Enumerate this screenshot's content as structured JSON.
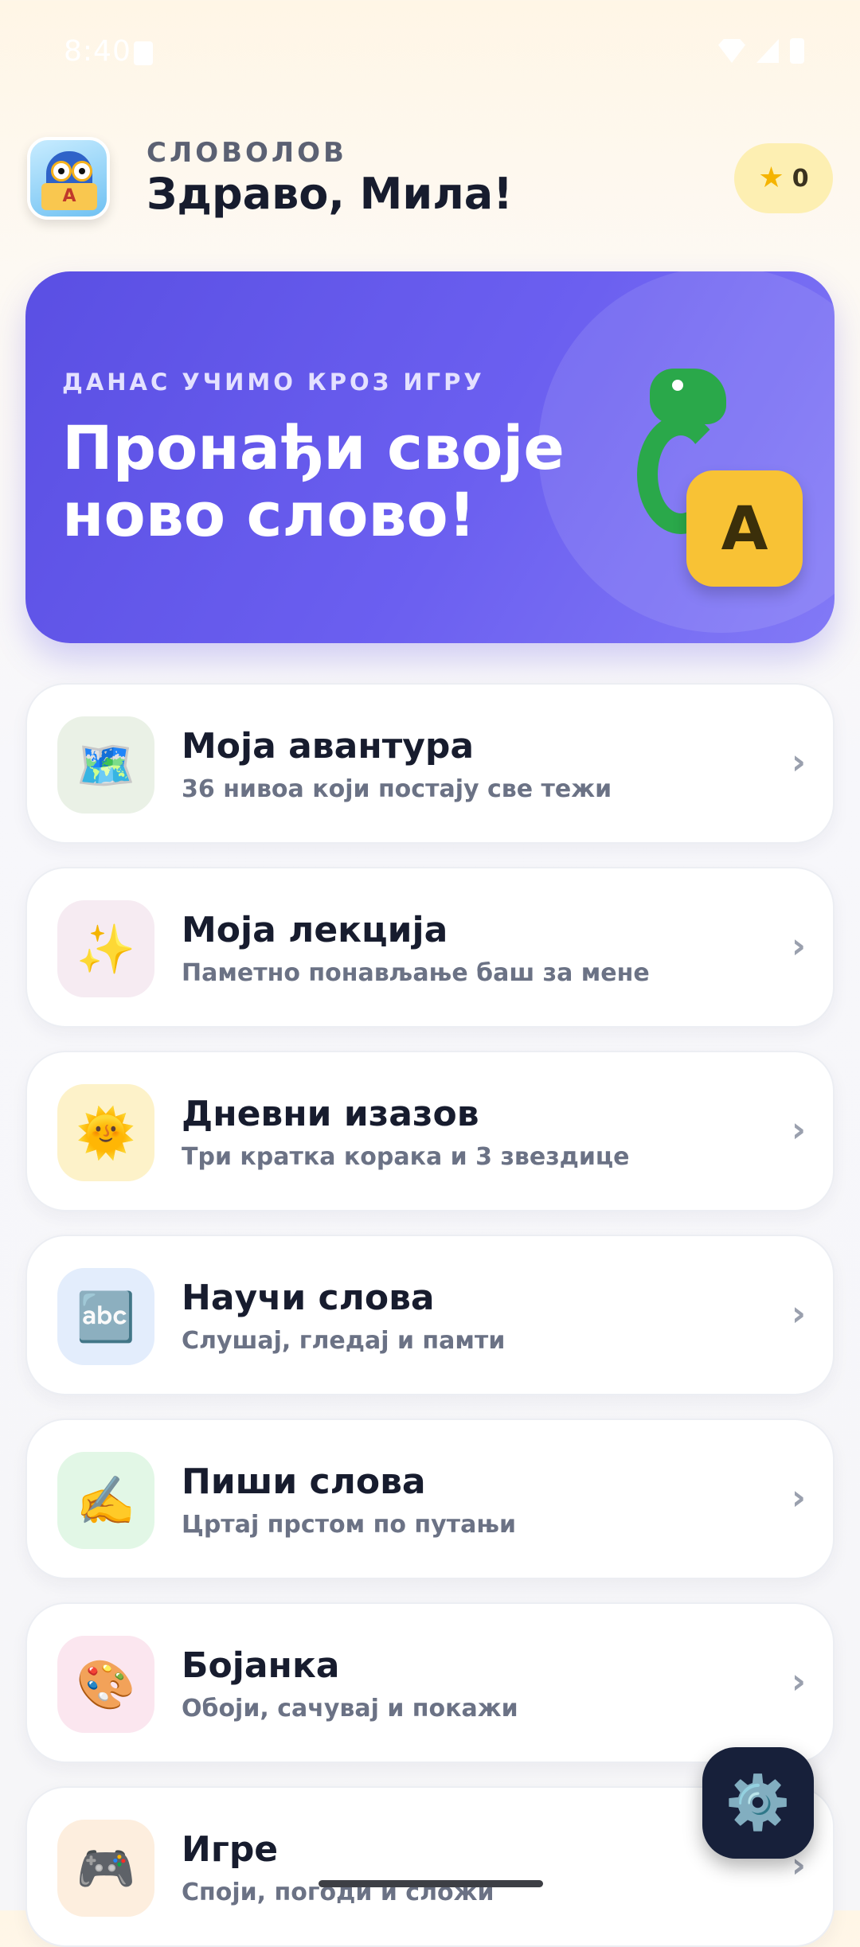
{
  "status_bar": {
    "time": "8:40"
  },
  "header": {
    "app_name": "СЛОВОЛОВ",
    "greeting": "Здраво, Мила!",
    "logo_letter": "A",
    "stars_count": "0"
  },
  "hero": {
    "kicker": "ДАНАС УЧИМО КРОЗ ИГРУ",
    "title": "Пронађи своје ново слово!",
    "letter": "А"
  },
  "menu": {
    "items": [
      {
        "title": "Моја авантура",
        "subtitle": "36 нивоа који постају све тежи",
        "icon": "🗺️",
        "icon_name": "map-icon",
        "tile_color": "#eaf1e6"
      },
      {
        "title": "Моја лекција",
        "subtitle": "Паметно понављање баш за мене",
        "icon": "✨",
        "icon_name": "sparkles-icon",
        "tile_color": "#f6ebf2"
      },
      {
        "title": "Дневни изазов",
        "subtitle": "Три кратка корака и 3 звездице",
        "icon": "🌞",
        "icon_name": "sun-icon",
        "tile_color": "#fdf2c9"
      },
      {
        "title": "Научи слова",
        "subtitle": "Слушај, гледај и памти",
        "icon": "🔤",
        "icon_name": "abc-icon",
        "tile_color": "#e3edfc"
      },
      {
        "title": "Пиши слова",
        "subtitle": "Цртај прстом по путањи",
        "icon": "✍️",
        "icon_name": "writing-hand-icon",
        "tile_color": "#e2f7e6"
      },
      {
        "title": "Бојанка",
        "subtitle": "Обоји, сачувај и покажи",
        "icon": "🎨",
        "icon_name": "palette-icon",
        "tile_color": "#fbe6ef"
      },
      {
        "title": "Игре",
        "subtitle": "Споји, погоди и сложи",
        "icon": "🎮",
        "icon_name": "gamepad-icon",
        "tile_color": "#fdeede"
      }
    ],
    "chevron": "›"
  },
  "settings": {
    "icon": "⚙️"
  },
  "colors": {
    "hero_start": "#5a4fe3",
    "hero_end": "#8279f6",
    "letter_tile": "#f8c235",
    "stars_badge": "#fdefb2",
    "fab": "#17203a"
  }
}
